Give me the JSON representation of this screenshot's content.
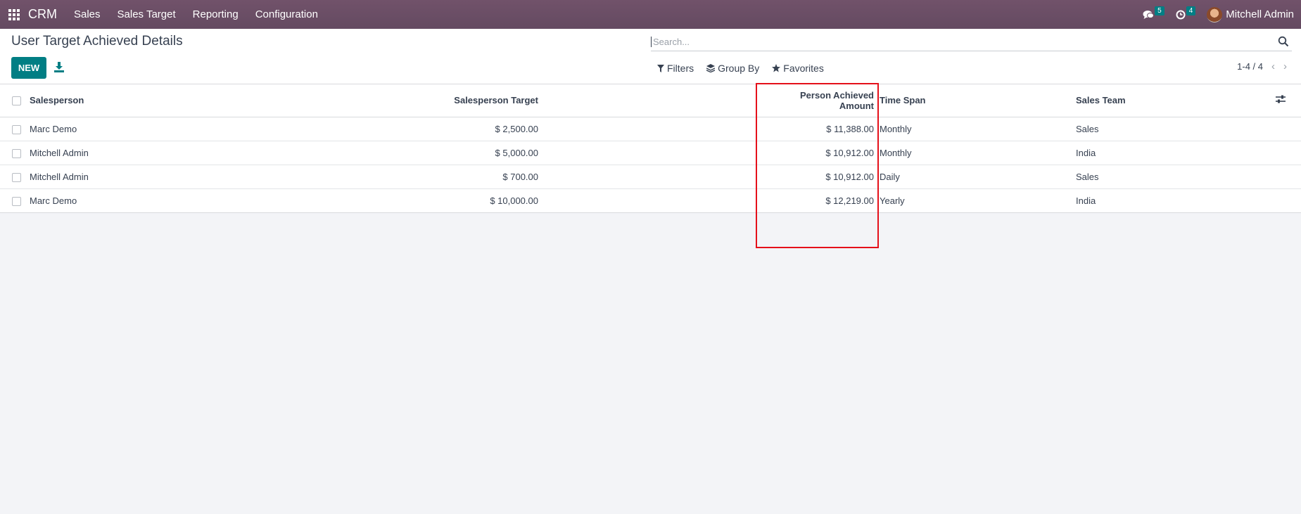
{
  "navbar": {
    "brand": "CRM",
    "menus": [
      "Sales",
      "Sales Target",
      "Reporting",
      "Configuration"
    ],
    "messages_count": "5",
    "activities_count": "4",
    "user_name": "Mitchell Admin"
  },
  "control_panel": {
    "title": "User Target Achieved Details",
    "new_label": "NEW",
    "search_placeholder": "Search...",
    "filters_label": "Filters",
    "groupby_label": "Group By",
    "favorites_label": "Favorites",
    "pager": "1-4 / 4"
  },
  "table": {
    "headers": {
      "salesperson": "Salesperson",
      "target": "Salesperson Target",
      "achieved": "Person Achieved Amount",
      "time_span": "Time Span",
      "sales_team": "Sales Team"
    },
    "rows": [
      {
        "salesperson": "Marc Demo",
        "target": "$ 2,500.00",
        "achieved": "$ 11,388.00",
        "time_span": "Monthly",
        "sales_team": "Sales"
      },
      {
        "salesperson": "Mitchell Admin",
        "target": "$ 5,000.00",
        "achieved": "$ 10,912.00",
        "time_span": "Monthly",
        "sales_team": "India"
      },
      {
        "salesperson": "Mitchell Admin",
        "target": "$ 700.00",
        "achieved": "$ 10,912.00",
        "time_span": "Daily",
        "sales_team": "Sales"
      },
      {
        "salesperson": "Marc Demo",
        "target": "$ 10,000.00",
        "achieved": "$ 12,219.00",
        "time_span": "Yearly",
        "sales_team": "India"
      }
    ]
  },
  "colors": {
    "navbar": "#714b67",
    "primary": "#017e84",
    "highlight": "#e5101a"
  }
}
